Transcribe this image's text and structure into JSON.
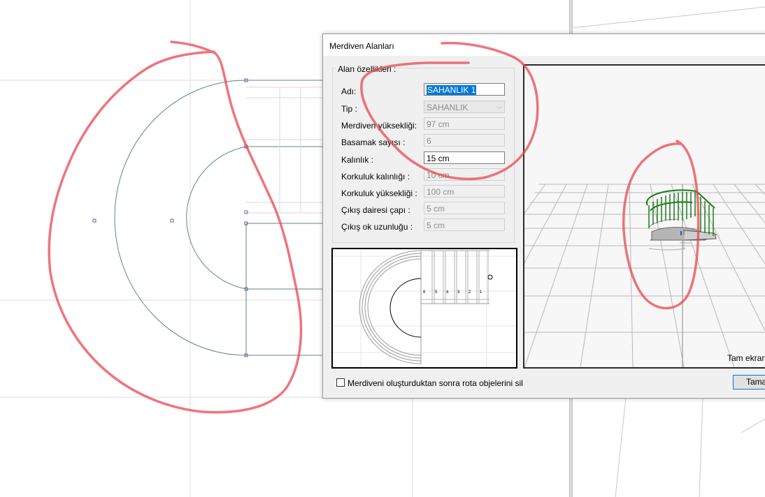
{
  "dialog": {
    "title": "Merdiven Alanları",
    "group_title": "Alan özellikleri :",
    "fields": [
      {
        "label": "Adı:",
        "value": "SAHANLIK 1",
        "state": "active-selected"
      },
      {
        "label": "Tip :",
        "value": "SAHANLIK",
        "state": "disabled-select"
      },
      {
        "label": "Merdiven yüksekliği:",
        "value": "97 cm",
        "state": "disabled"
      },
      {
        "label": "Basamak sayısı :",
        "value": "6",
        "state": "disabled"
      },
      {
        "label": "Kalınlık :",
        "value": "15 cm",
        "state": "active"
      },
      {
        "label": "Korkuluk kalınlığı :",
        "value": "10 cm",
        "state": "disabled"
      },
      {
        "label": "Korkuluk yüksekliği :",
        "value": "100 cm",
        "state": "disabled"
      },
      {
        "label": "Çıkış dairesi çapı :",
        "value": "5 cm",
        "state": "disabled"
      },
      {
        "label": "Çıkış ok uzunluğu :",
        "value": "5 cm",
        "state": "disabled"
      }
    ],
    "plan_step_numbers": [
      "6",
      "5",
      "4",
      "3",
      "2",
      "1"
    ],
    "view3d_fullscreen_label": "Tam ekran",
    "checkbox_label": "Merdiveni oluşturduktan sonra rota objelerini sil",
    "checkbox_checked": false,
    "ok_button": "Tamam"
  },
  "colors": {
    "selection": "#0078d7",
    "annotation": "#e8474f",
    "railing": "#1e7a1e"
  }
}
